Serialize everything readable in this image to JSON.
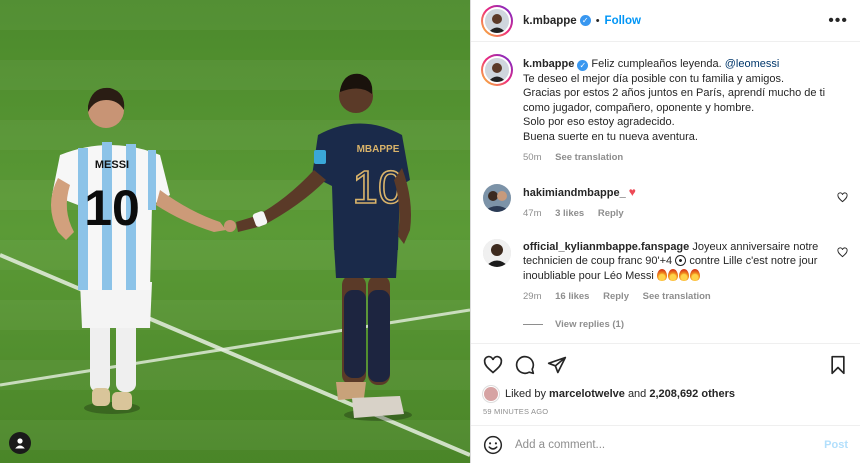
{
  "header": {
    "username": "k.mbappe",
    "separator": "•",
    "follow_label": "Follow",
    "more_label": "•••"
  },
  "caption": {
    "username": "k.mbappe",
    "lines": [
      "Feliz cumpleaños leyenda.",
      "Te deseo el mejor día posible con tu familia y amigos.",
      "Gracias por estos 2 años juntos en París, aprendí mucho de ti",
      "como jugador, compañero, oponente y hombre.",
      "Solo por eso estoy agradecido.",
      "Buena suerte en tu nueva aventura."
    ],
    "mention": "@leomessi",
    "time": "50m",
    "see_translation": "See translation"
  },
  "comments": [
    {
      "username": "hakimiandmbappe_",
      "text": "",
      "emoji": "red-heart",
      "emoji_glyph": "♥",
      "time": "47m",
      "likes": "3 likes",
      "reply": "Reply"
    },
    {
      "username": "official_kylianmbappe.fanspage",
      "text_a": "Joyeux anniversaire notre technicien de coup franc 90'+4",
      "text_b": "contre Lille c'est notre jour inoubliable pour Léo Messi",
      "time": "29m",
      "likes": "16 likes",
      "reply": "Reply",
      "see_translation": "See translation",
      "view_replies": "View replies (1)"
    }
  ],
  "likes": {
    "prefix": "Liked by",
    "user": "marcelotwelve",
    "and": "and",
    "count": "2,208,692 others"
  },
  "timestamp": "59 MINUTES AGO",
  "composer": {
    "placeholder": "Add a comment...",
    "post_label": "Post"
  },
  "photo": {
    "left_player_name": "MESSI",
    "left_player_number": "10",
    "right_player_name": "MBAPPE",
    "right_player_number": "10"
  },
  "colors": {
    "accent": "#0095f6",
    "verified": "#3897f0",
    "pitch": "#4f8a2e",
    "france_kit": "#1a2a4a",
    "argentina_stripe": "#8cc3e8"
  }
}
